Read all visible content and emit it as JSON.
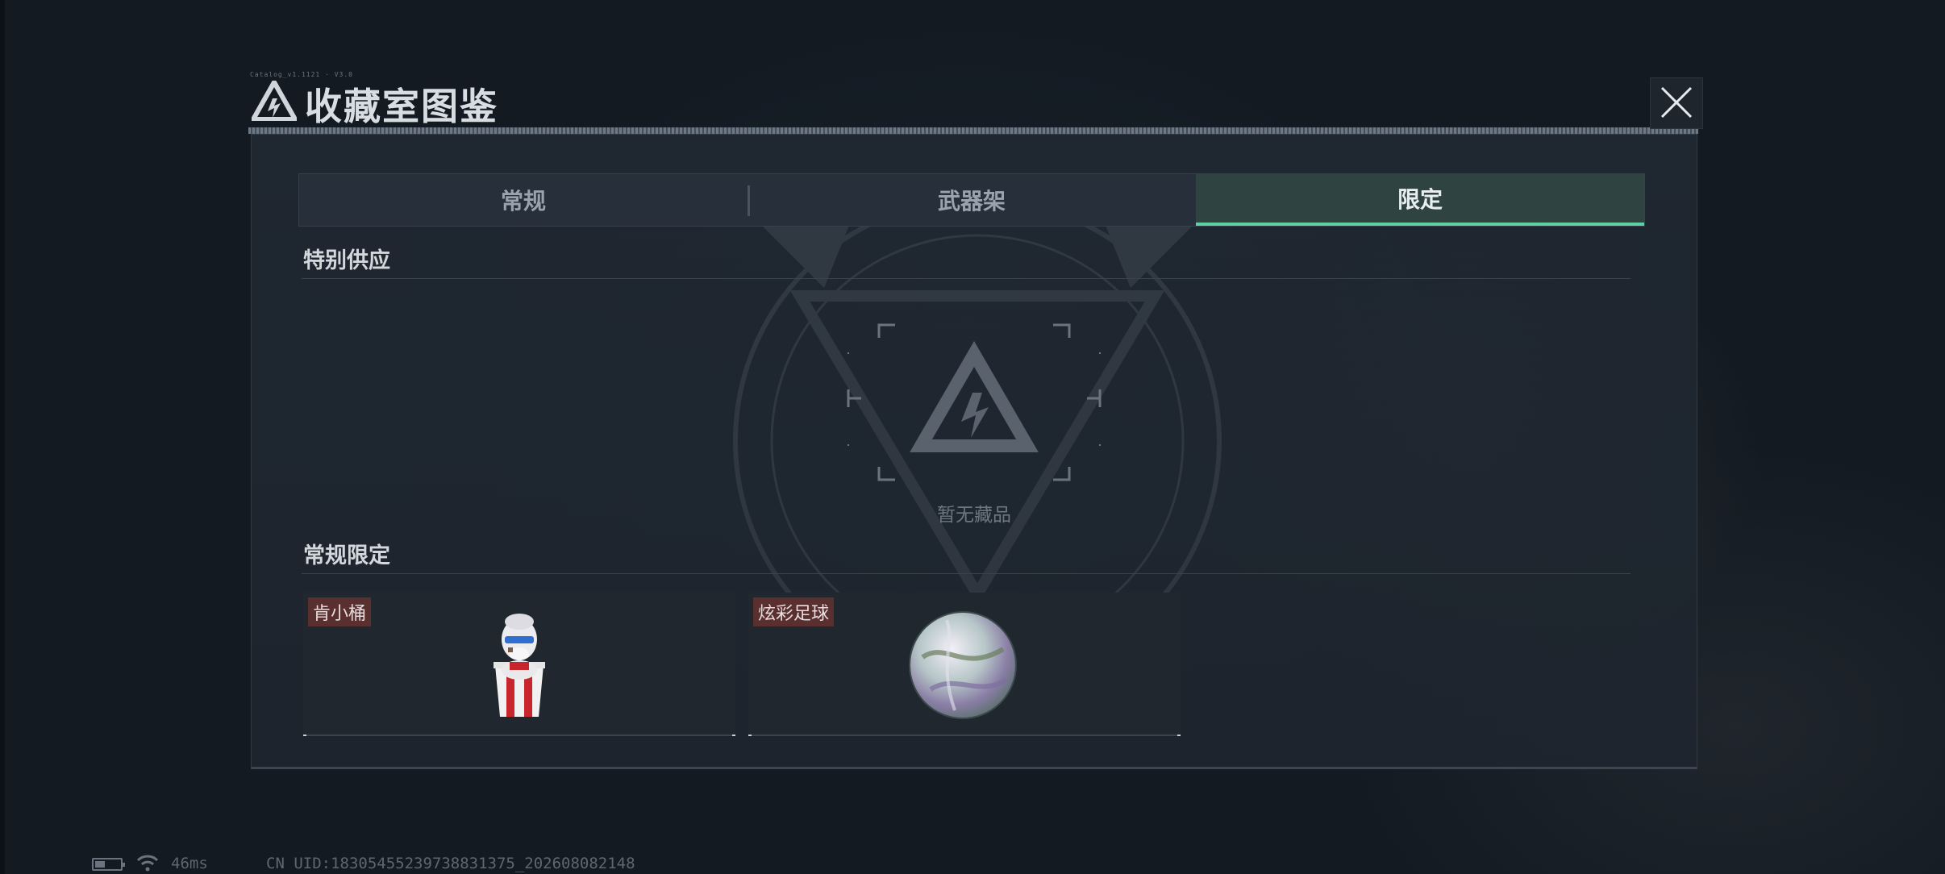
{
  "window": {
    "title": "收藏室图鉴",
    "title_code": "Catalog_v1.1121 · V3.0"
  },
  "tabs": [
    {
      "label": "常规",
      "active": false
    },
    {
      "label": "武器架",
      "active": false
    },
    {
      "label": "限定",
      "active": true
    }
  ],
  "sections": {
    "special_supply": {
      "title": "特别供应",
      "empty_text": "暂无藏品"
    },
    "regular_limited": {
      "title": "常规限定",
      "items": [
        {
          "name": "肯小桶",
          "icon": "bucket-mascot-figure"
        },
        {
          "name": "炫彩足球",
          "icon": "iridescent-football"
        }
      ]
    }
  },
  "status_bar": {
    "battery_icon": "battery-icon",
    "wifi_icon": "wifi-icon",
    "ping": "46ms",
    "uid": "CN UID:18305455239738831375_202608082148"
  },
  "colors": {
    "accent": "#5fd0a3",
    "tag_background": "#5a2f30",
    "panel_background": "#1e252e"
  }
}
